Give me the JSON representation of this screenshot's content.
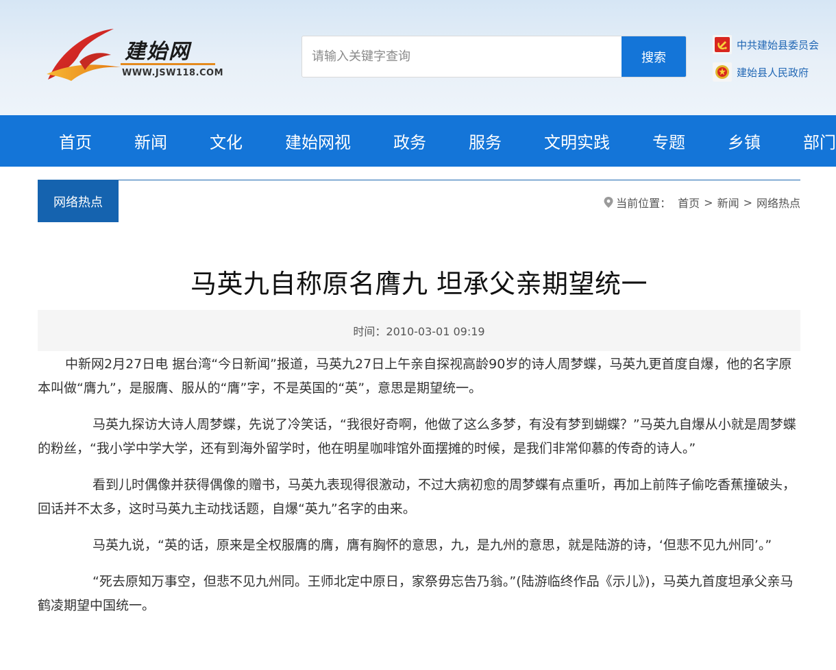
{
  "header": {
    "logo_text": "建始网",
    "logo_url": "WWW.JSW118.COM",
    "search": {
      "placeholder": "请输入关键字查询",
      "button_label": "搜索"
    },
    "gov_links": [
      {
        "label": "中共建始县委员会",
        "icon": "party-emblem-icon"
      },
      {
        "label": "建始县人民政府",
        "icon": "national-emblem-icon"
      }
    ]
  },
  "nav": {
    "items": [
      "首页",
      "新闻",
      "文化",
      "建始网视",
      "政务",
      "服务",
      "文明实践",
      "专题",
      "乡镇",
      "部门"
    ]
  },
  "section": {
    "tag": "网络热点",
    "location_label": "当前位置：",
    "breadcrumb": [
      "首页",
      "新闻",
      "网络热点"
    ],
    "separator": ">"
  },
  "article": {
    "title": "马英九自称原名膺九 坦承父亲期望统一",
    "time": "时间：2010-03-01 09:19",
    "paragraphs": [
      "中新网2月27日电 据台湾“今日新闻”报道，马英九27日上午亲自探视高龄90岁的诗人周梦蝶，马英九更首度自爆，他的名字原本叫做“膺九”，是服膺、服从的“膺”字，不是英国的“英”，意思是期望统一。",
      "马英九探访大诗人周梦蝶，先说了冷笑话，“我很好奇啊，他做了这么多梦，有没有梦到蝴蝶？”马英九自爆从小就是周梦蝶的粉丝，“我小学中学大学，还有到海外留学时，他在明星咖啡馆外面摆摊的时候，是我们非常仰慕的传奇的诗人。”",
      "看到儿时偶像并获得偶像的赠书，马英九表现得很激动，不过大病初愈的周梦蝶有点重听，再加上前阵子偷吃香蕉撞破头，回话并不太多，这时马英九主动找话题，自爆“英九”名字的由来。",
      "马英九说，“英的话，原来是全权服膺的膺，膺有胸怀的意思，九，是九州的意思，就是陆游的诗，‘但悲不见九州同’。”",
      "“死去原知万事空，但悲不见九州同。王师北定中原日，家祭毋忘告乃翁。”(陆游临终作品《示儿》)，马英九首度坦承父亲马鹤凌期望中国统一。"
    ]
  },
  "colors": {
    "nav_bg": "#1475d8",
    "section_tag_bg": "#1563af",
    "gov_link": "#2167b4"
  }
}
